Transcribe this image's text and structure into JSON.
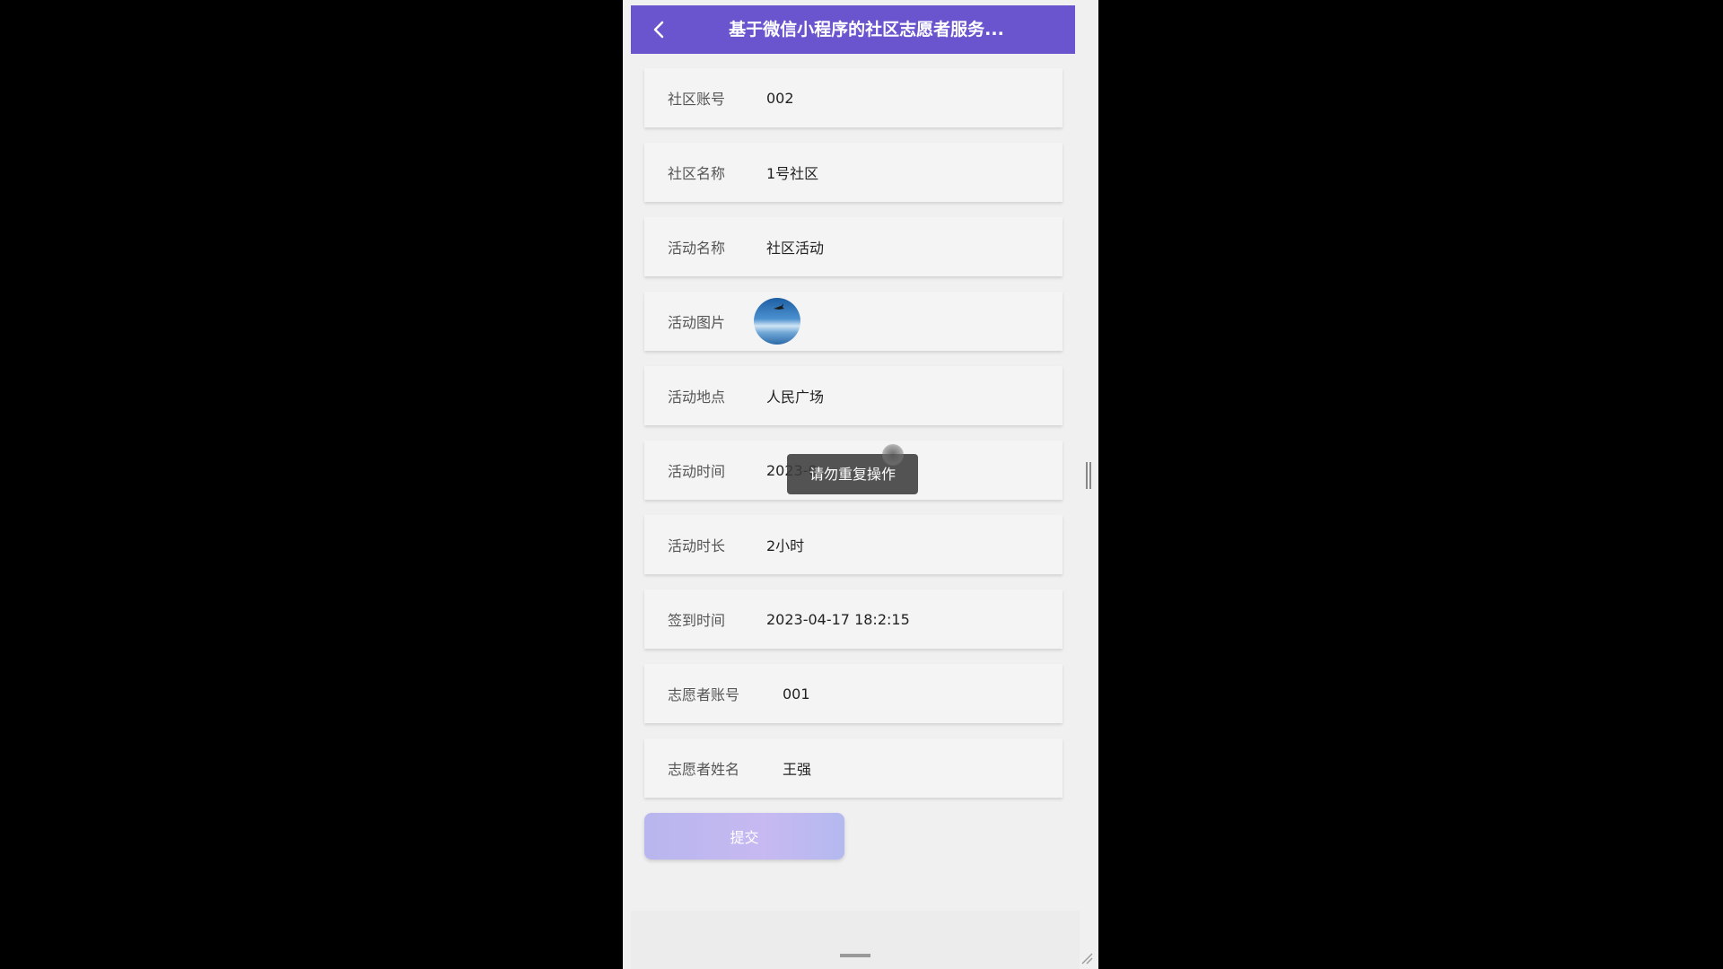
{
  "navbar": {
    "title": "基于微信小程序的社区志愿者服务..."
  },
  "fields": [
    {
      "label": "社区账号",
      "value": "002"
    },
    {
      "label": "社区名称",
      "value": "1号社区"
    },
    {
      "label": "活动名称",
      "value": "社区活动"
    },
    {
      "label": "活动图片",
      "value": ""
    },
    {
      "label": "活动地点",
      "value": "人民广场"
    },
    {
      "label": "活动时间",
      "value": "2023-0"
    },
    {
      "label": "活动时长",
      "value": "2小时"
    },
    {
      "label": "签到时间",
      "value": "2023-04-17 18:2:15"
    },
    {
      "label": "志愿者账号",
      "value": "001"
    },
    {
      "label": "志愿者姓名",
      "value": "王强"
    }
  ],
  "submit_label": "提交",
  "toast": "请勿重复操作",
  "colors": {
    "navbar": "#6a55cf",
    "submit_gradient_start": "#b8b6ee",
    "submit_gradient_end": "#b4b9f0"
  },
  "icons": {
    "back": "chevron-left-icon",
    "activity_image": "sky-photo-thumbnail"
  }
}
